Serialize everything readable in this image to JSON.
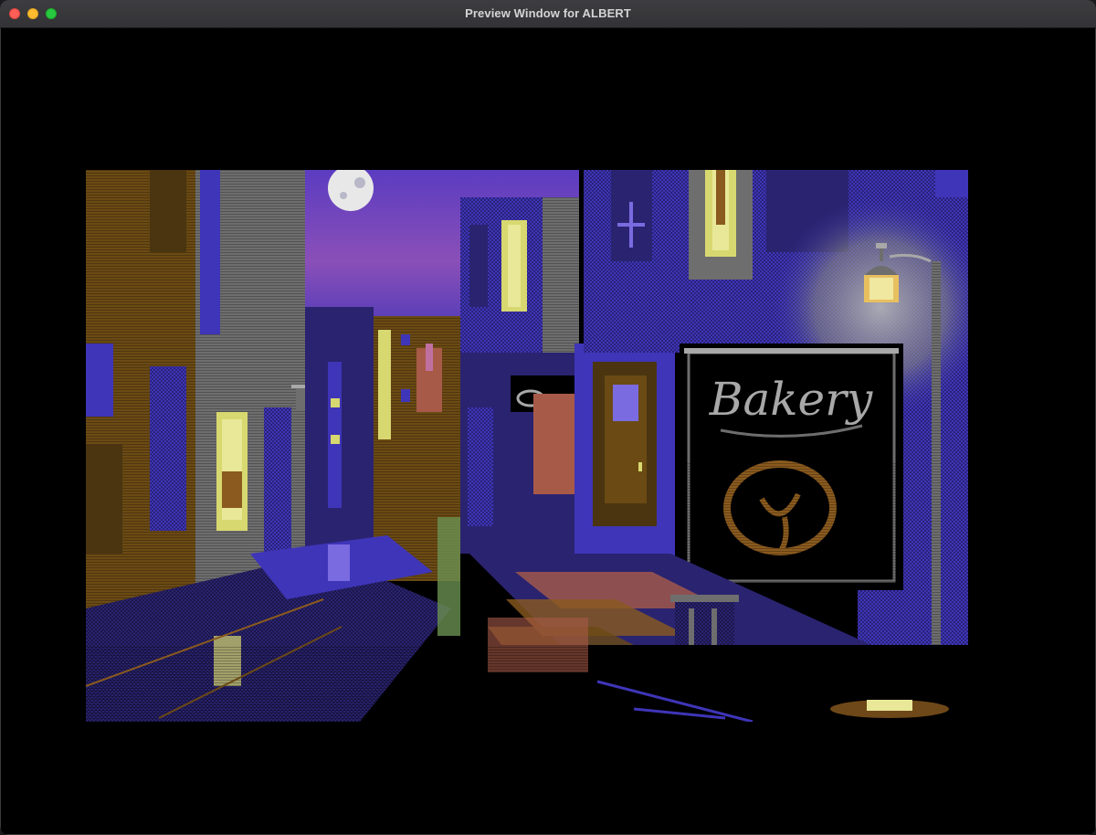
{
  "window": {
    "title": "Preview Window for ALBERT"
  },
  "scene": {
    "sign_text": "Bakery",
    "palette": {
      "black": "#000000",
      "blue": "#3f35b8",
      "purple": "#6a3fc0",
      "light_blue": "#7a6be0",
      "brown": "#6b4a14",
      "orange": "#8a5a1e",
      "yellow": "#d8d870",
      "pale_yellow": "#e8e898",
      "grey": "#6e6e6e",
      "light_grey": "#a8a8a8",
      "white": "#f0f0f0",
      "pink": "#c070a0",
      "red": "#a85a48"
    }
  }
}
